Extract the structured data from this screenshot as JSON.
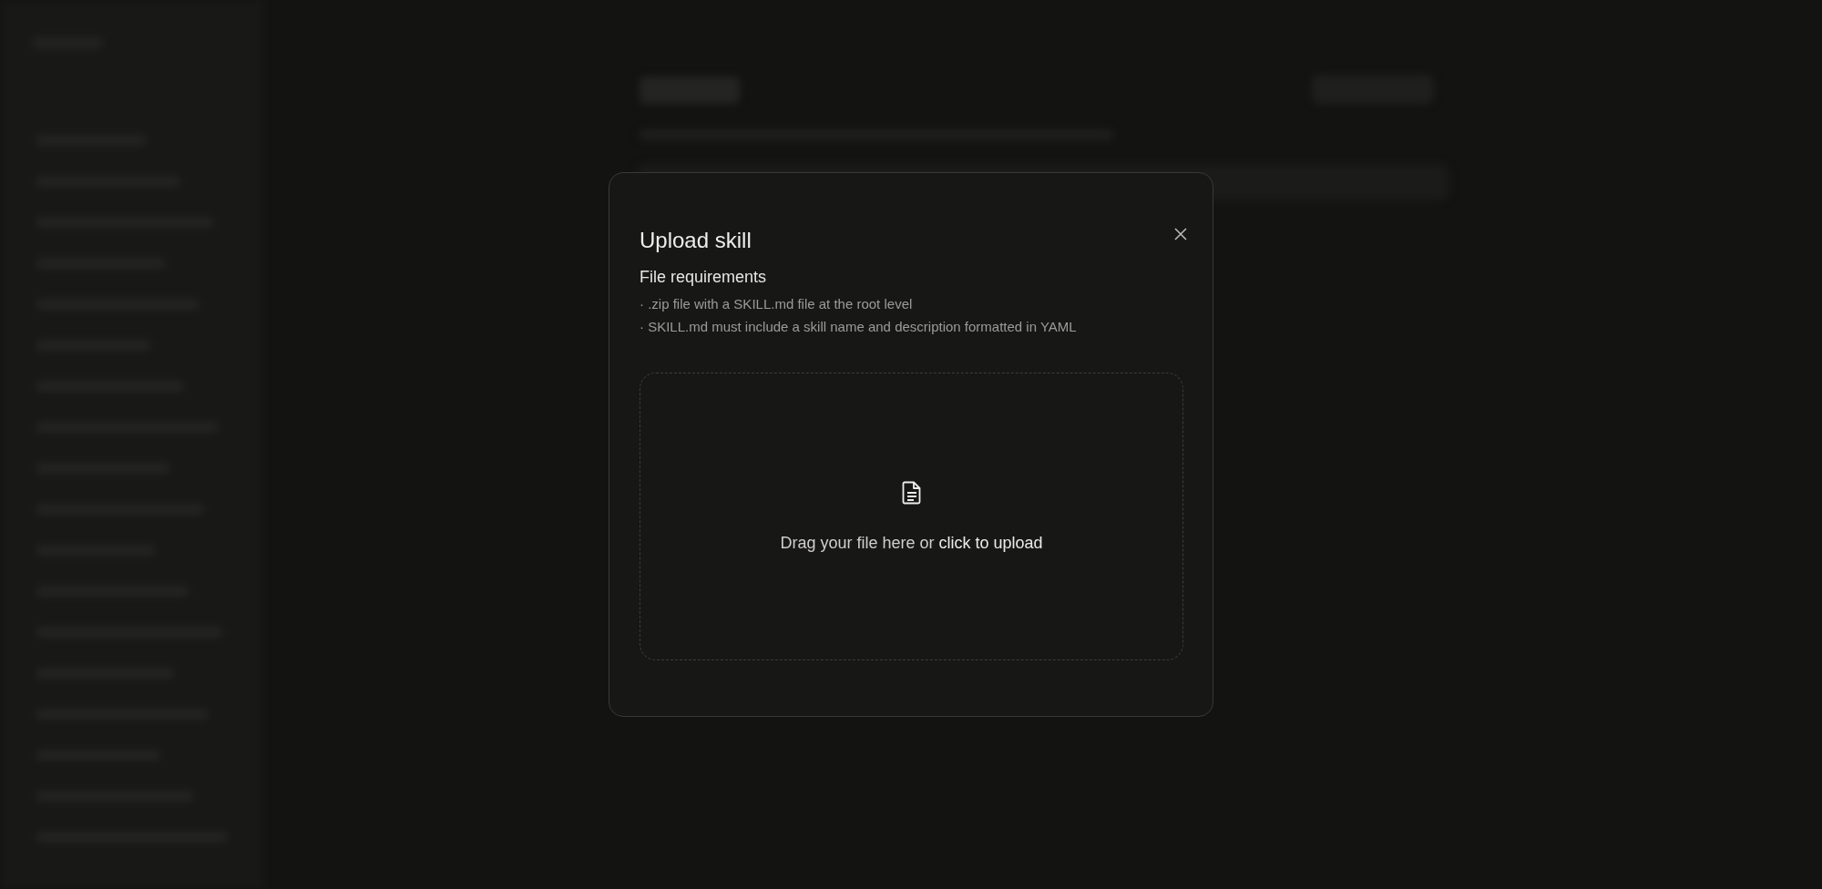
{
  "dialog": {
    "title": "Upload skill",
    "requirements_heading": "File requirements",
    "requirements": [
      "· .zip file with a SKILL.md file at the root level",
      "· SKILL.md must include a skill name and description formatted in YAML"
    ],
    "dropzone": {
      "text": "Drag your file here or ",
      "link": "click to upload"
    }
  }
}
